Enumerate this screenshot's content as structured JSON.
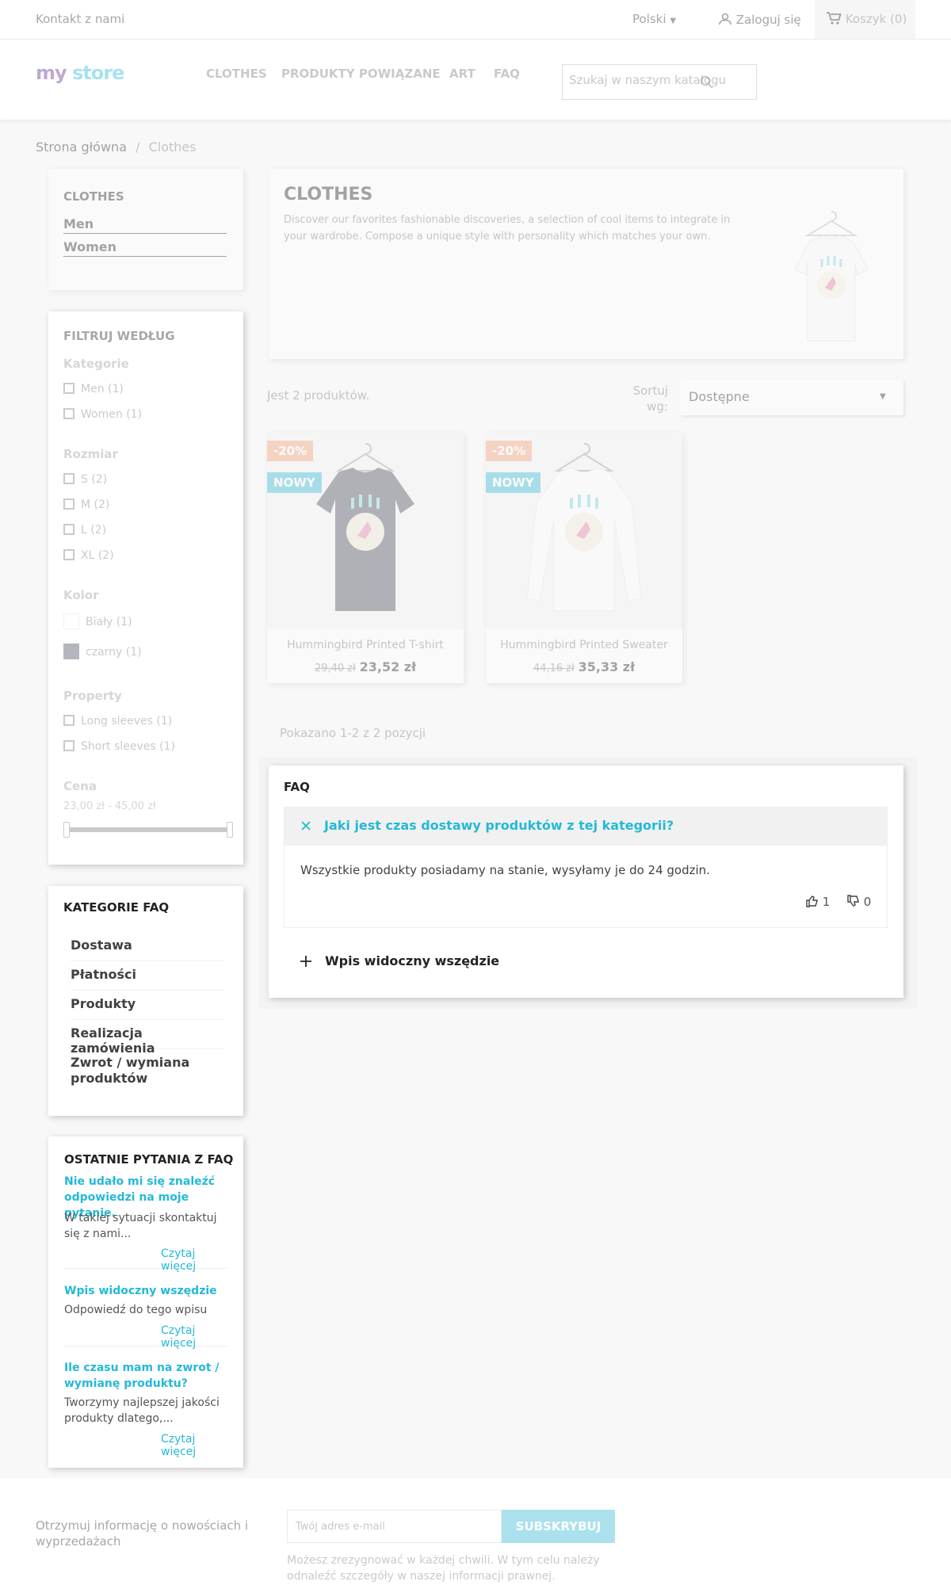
{
  "topbar": {
    "contact": "Kontakt z nami",
    "language": "Polski",
    "login": "Zaloguj się",
    "cart": "Koszyk (0)"
  },
  "header": {
    "logo_part1": "my",
    "logo_part2": "store",
    "nav": [
      "CLOTHES",
      "PRODUKTY POWIĄZANE",
      "ART",
      "FAQ"
    ],
    "search_placeholder": "Szukaj w naszym katalogu"
  },
  "breadcrumb": {
    "home": "Strona główna",
    "separator": "/",
    "current": "Clothes"
  },
  "category_block": {
    "title": "CLOTHES",
    "items": [
      "Men",
      "Women"
    ]
  },
  "filters": {
    "title": "FILTRUJ WEDŁUG",
    "category_label": "Kategorie",
    "categories": [
      "Men (1)",
      "Women (1)"
    ],
    "size_label": "Rozmiar",
    "sizes": [
      "S (2)",
      "M (2)",
      "L (2)",
      "XL (2)"
    ],
    "color_label": "Kolor",
    "colors": [
      {
        "label": "Biały (1)",
        "swatch": "#ffffff"
      },
      {
        "label": "czarny (1)",
        "swatch": "#434A54"
      }
    ],
    "property_label": "Property",
    "properties": [
      "Long sleeves (1)",
      "Short sleeves (1)"
    ],
    "price_label": "Cena",
    "price_range": "23,00 zł - 45,00 zł"
  },
  "category_header": {
    "title": "CLOTHES",
    "description": "Discover our favorites fashionable discoveries, a selection of cool items to integrate in your wardrobe. Compose a unique style with personality which matches your own."
  },
  "listing": {
    "count_text": "Jest 2 produktów.",
    "sort_label": "Sortuj wg:",
    "sort_value": "Dostępne",
    "showing": "Pokazano 1-2 z 2 pozycji"
  },
  "products": [
    {
      "name": "Hummingbird Printed T-shirt",
      "old_price": "29,40 zł",
      "price": "23,52 zł",
      "discount": "-20%",
      "flag": "NOWY"
    },
    {
      "name": "Hummingbird Printed Sweater",
      "old_price": "44,16 zł",
      "price": "35,33 zł",
      "discount": "-20%",
      "flag": "NOWY"
    }
  ],
  "faq_panel": {
    "title": "FAQ",
    "question": "Jaki jest czas dostawy produktów z tej kategorii?",
    "answer": "Wszystkie produkty posiadamy na stanie, wysyłamy je do 24 godzin.",
    "likes": "1",
    "dislikes": "0",
    "collapsed_question": "Wpis widoczny wszędzie"
  },
  "faq_categories": {
    "title": "KATEGORIE FAQ",
    "items": [
      "Dostawa",
      "Płatności",
      "Produkty",
      "Realizacja zamówienia",
      "Zwrot / wymiana produktów"
    ]
  },
  "recent_faq": {
    "title": "OSTATNIE PYTANIA Z FAQ",
    "read_more": "Czytaj więcej",
    "items": [
      {
        "q": "Nie udało mi się znaleźć odpowiedzi na moje pytanie.",
        "a": "W takiej sytuacji skontaktuj się z nami..."
      },
      {
        "q": "Wpis widoczny wszędzie",
        "a": "Odpowiedź do tego wpisu"
      },
      {
        "q": "Ile czasu mam na zwrot / wymianę produktu?",
        "a": "Tworzymy najlepszej jakości produkty dlatego,..."
      }
    ]
  },
  "newsletter": {
    "label": "Otrzymuj informację o nowościach i wyprzedażach",
    "placeholder": "Twój adres e-mail",
    "button": "SUBSKRYBUJ",
    "note": "Możesz zrezygnować w każdej chwili. W tym celu należy odnaleźć szczegóły w naszej informacji prawnej."
  },
  "colors": {
    "accent": "#24b9d7",
    "discount": "#f39d72",
    "new_flag": "#2fb5d2"
  }
}
